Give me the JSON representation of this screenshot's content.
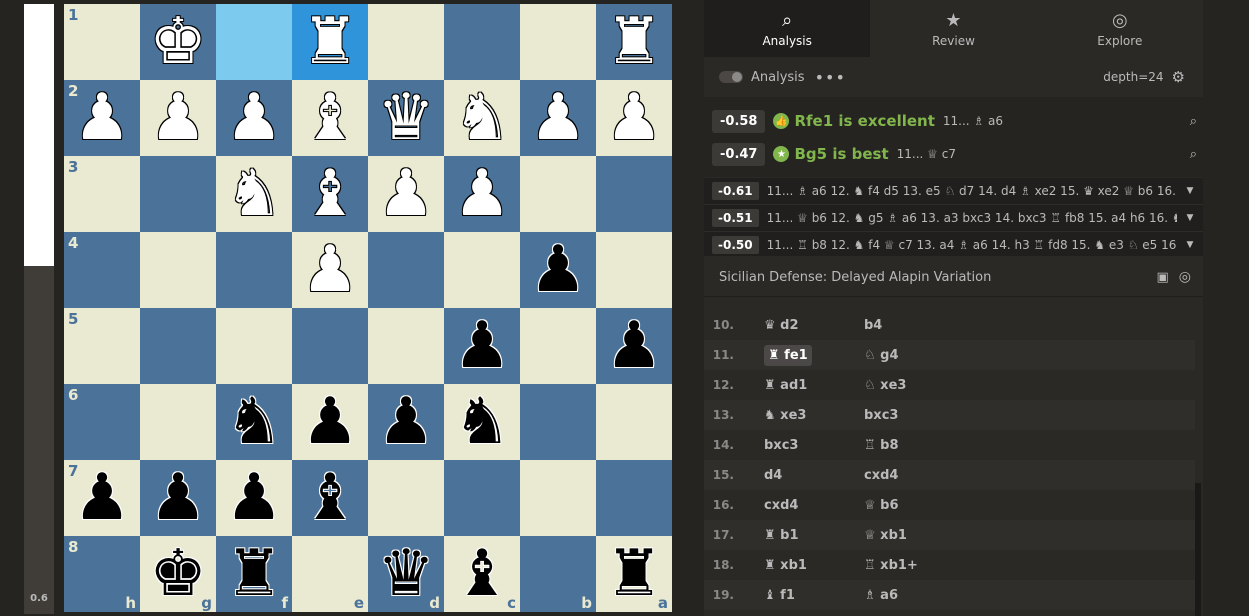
{
  "eval_bar": {
    "label": "0.6",
    "white_fraction": 0.43
  },
  "board": {
    "ranks": [
      "1",
      "2",
      "3",
      "4",
      "5",
      "6",
      "7",
      "8"
    ],
    "files": [
      "h",
      "g",
      "f",
      "e",
      "d",
      "c",
      "b",
      "a"
    ],
    "highlights": [
      "f1",
      "e1"
    ],
    "squares": [
      [
        "",
        "wK",
        "",
        "wR",
        "",
        "",
        "",
        "wR"
      ],
      [
        "wP",
        "wP",
        "wP",
        "wB",
        "wQ",
        "wN",
        "wP",
        "wP"
      ],
      [
        "",
        "",
        "wN",
        "wB",
        "wP",
        "wP",
        "",
        ""
      ],
      [
        "",
        "",
        "",
        "wP",
        "",
        "",
        "bP",
        ""
      ],
      [
        "",
        "",
        "",
        "",
        "",
        "bP",
        "",
        "bP"
      ],
      [
        "",
        "",
        "bN",
        "bP",
        "bP",
        "bN",
        "",
        ""
      ],
      [
        "bP",
        "bP",
        "bP",
        "bB",
        "",
        "",
        "",
        ""
      ],
      [
        "",
        "bK",
        "bR",
        "",
        "bQ",
        "bB",
        "",
        "bR"
      ]
    ]
  },
  "tabs": [
    {
      "label": "Analysis",
      "icon": "magnifier-icon",
      "active": true
    },
    {
      "label": "Review",
      "icon": "star-icon",
      "active": false
    },
    {
      "label": "Explore",
      "icon": "compass-icon",
      "active": false
    }
  ],
  "toolbar": {
    "analysis_label": "Analysis",
    "depth_label": "depth=24"
  },
  "coach": [
    {
      "score": "-0.58",
      "text": "Rfe1 is excellent",
      "reply": "11... ♗ a6",
      "badge": "thumbs-up-icon"
    },
    {
      "score": "-0.47",
      "text": "Bg5 is best",
      "reply": "11... ♕ c7",
      "badge": "star-icon"
    }
  ],
  "engine_lines": [
    {
      "score": "-0.61",
      "text": "11... ♗ a6 12. ♞ f4 d5 13. e5 ♘ d7 14. d4 ♗ xe2 15. ♛ xe2 ♕ b6 16. ..."
    },
    {
      "score": "-0.51",
      "text": "11... ♕ b6 12. ♞ g5 ♗ a6 13. a3 bxc3 14. bxc3 ♖ fb8 15. a4 h6 16. ♞ ..."
    },
    {
      "score": "-0.50",
      "text": "11... ♖ b8 12. ♞ f4 ♕ c7 13. a4 ♗ a6 14. h3 ♖ fd8 15. ♞ e3 ♘ e5 16...."
    }
  ],
  "opening": "Sicilian Defense: Delayed Alapin Variation",
  "moves": [
    {
      "num": "10.",
      "white": "♛ d2",
      "black": "b4"
    },
    {
      "num": "11.",
      "white": "♜ fe1",
      "black": "♘ g4",
      "selected": true
    },
    {
      "num": "12.",
      "white": "♜ ad1",
      "black": "♘ xe3"
    },
    {
      "num": "13.",
      "white": "♞ xe3",
      "black": "bxc3"
    },
    {
      "num": "14.",
      "white": "bxc3",
      "black": "♖ b8"
    },
    {
      "num": "15.",
      "white": "d4",
      "black": "cxd4"
    },
    {
      "num": "16.",
      "white": "cxd4",
      "black": "♕ b6"
    },
    {
      "num": "17.",
      "white": "♜ b1",
      "black": "♕ xb1"
    },
    {
      "num": "18.",
      "white": "♜ xb1",
      "black": "♖ xb1+"
    },
    {
      "num": "19.",
      "white": "♝ f1",
      "black": "♗ a6"
    }
  ]
}
